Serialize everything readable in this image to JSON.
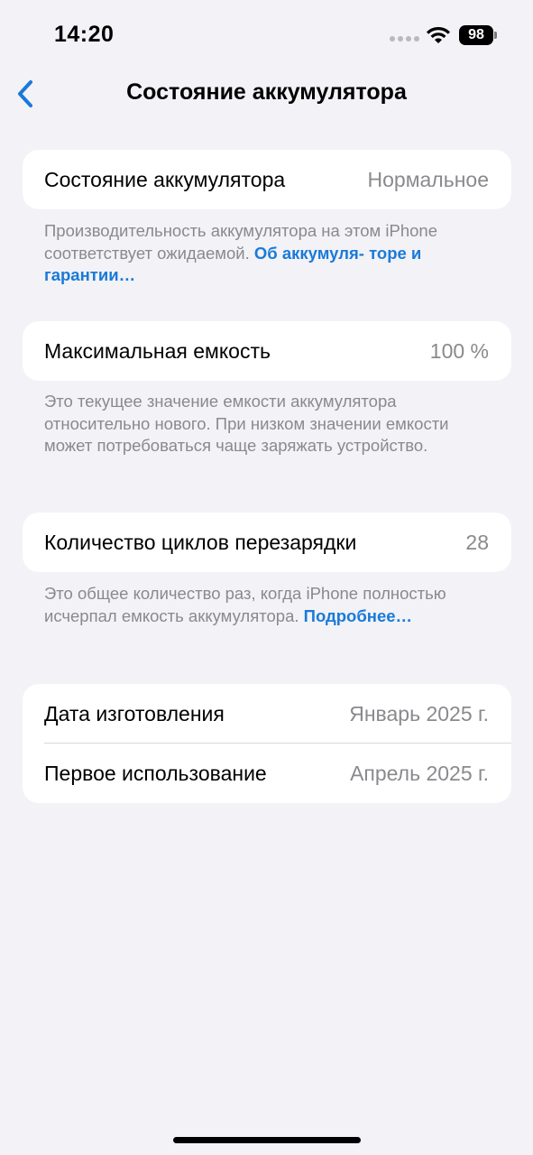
{
  "status_bar": {
    "time": "14:20",
    "battery_level": "98",
    "icons": [
      "signal-dots-icon",
      "wifi-icon",
      "battery-icon"
    ]
  },
  "nav": {
    "back_icon": "chevron-left-icon",
    "title": "Состояние аккумулятора"
  },
  "battery_health": {
    "label": "Состояние аккумулятора",
    "value": "Нормальное",
    "footnote_text": "Производительность аккумулятора на этом iPhone соответствует ожидаемой.",
    "footnote_link_line1": "Об аккумуля-",
    "footnote_link_line2": "торе и гарантии…"
  },
  "max_capacity": {
    "label": "Максимальная емкость",
    "value": "100 %",
    "footnote": "Это текущее значение емкости аккумулятора относительно нового. При низком значении емкости может потребоваться чаще заряжать устройство."
  },
  "cycle_count": {
    "label": "Количество циклов перезарядки",
    "value": "28",
    "footnote_text": "Это общее количество раз, когда iPhone полностью исчерпал емкость аккумулятора.",
    "footnote_link": "Подробнее…"
  },
  "dates": {
    "manufacture_label": "Дата изготовления",
    "manufacture_value": "Январь 2025 г.",
    "first_use_label": "Первое использование",
    "first_use_value": "Апрель 2025 г."
  },
  "colors": {
    "background": "#f2f2f7",
    "card": "#ffffff",
    "secondary_text": "#8a8a8e",
    "link": "#1a7ad8"
  }
}
